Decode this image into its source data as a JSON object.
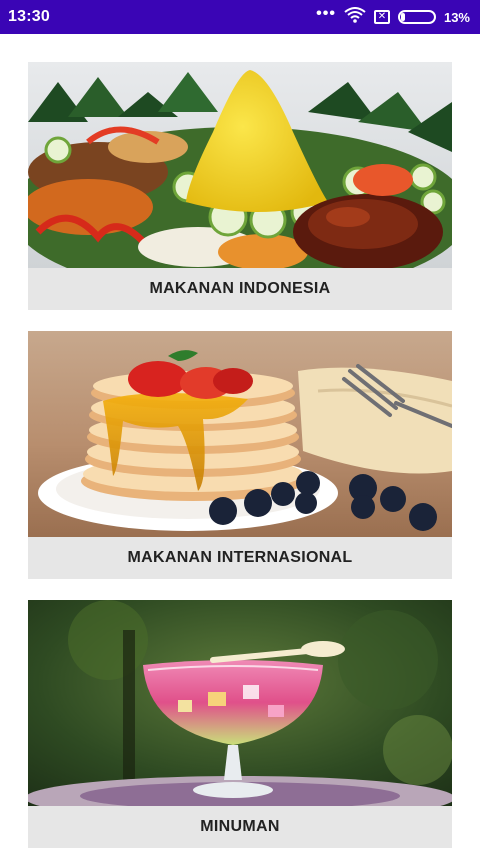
{
  "status_bar": {
    "time": "13:30",
    "more_dots": "•••",
    "battery_percent": "13%",
    "battery_level": 0.13,
    "icons": [
      "wifi-icon",
      "no-sim-icon",
      "battery-icon"
    ]
  },
  "menu": {
    "items": [
      {
        "label": "MAKANAN INDONESIA",
        "image": "tumpeng-rice-cone-photo"
      },
      {
        "label": "MAKANAN INTERNASIONAL",
        "image": "pancake-stack-photo"
      },
      {
        "label": "MINUMAN",
        "image": "fruit-ice-drink-photo"
      }
    ]
  },
  "colors": {
    "status_bar": "#3a05b5",
    "label_background": "#e6e6e6",
    "label_text": "#222222"
  }
}
